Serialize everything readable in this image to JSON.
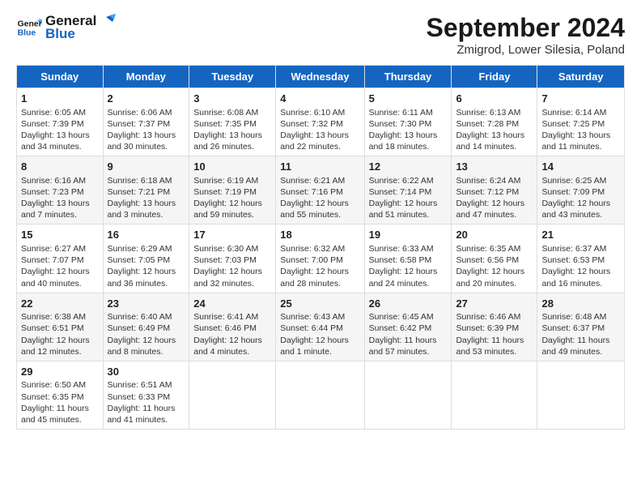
{
  "logo": {
    "line1": "General",
    "line2": "Blue"
  },
  "title": "September 2024",
  "subtitle": "Zmigrod, Lower Silesia, Poland",
  "headers": [
    "Sunday",
    "Monday",
    "Tuesday",
    "Wednesday",
    "Thursday",
    "Friday",
    "Saturday"
  ],
  "weeks": [
    [
      {
        "day": "1",
        "sunrise": "Sunrise: 6:05 AM",
        "sunset": "Sunset: 7:39 PM",
        "daylight": "Daylight: 13 hours and 34 minutes."
      },
      {
        "day": "2",
        "sunrise": "Sunrise: 6:06 AM",
        "sunset": "Sunset: 7:37 PM",
        "daylight": "Daylight: 13 hours and 30 minutes."
      },
      {
        "day": "3",
        "sunrise": "Sunrise: 6:08 AM",
        "sunset": "Sunset: 7:35 PM",
        "daylight": "Daylight: 13 hours and 26 minutes."
      },
      {
        "day": "4",
        "sunrise": "Sunrise: 6:10 AM",
        "sunset": "Sunset: 7:32 PM",
        "daylight": "Daylight: 13 hours and 22 minutes."
      },
      {
        "day": "5",
        "sunrise": "Sunrise: 6:11 AM",
        "sunset": "Sunset: 7:30 PM",
        "daylight": "Daylight: 13 hours and 18 minutes."
      },
      {
        "day": "6",
        "sunrise": "Sunrise: 6:13 AM",
        "sunset": "Sunset: 7:28 PM",
        "daylight": "Daylight: 13 hours and 14 minutes."
      },
      {
        "day": "7",
        "sunrise": "Sunrise: 6:14 AM",
        "sunset": "Sunset: 7:25 PM",
        "daylight": "Daylight: 13 hours and 11 minutes."
      }
    ],
    [
      {
        "day": "8",
        "sunrise": "Sunrise: 6:16 AM",
        "sunset": "Sunset: 7:23 PM",
        "daylight": "Daylight: 13 hours and 7 minutes."
      },
      {
        "day": "9",
        "sunrise": "Sunrise: 6:18 AM",
        "sunset": "Sunset: 7:21 PM",
        "daylight": "Daylight: 13 hours and 3 minutes."
      },
      {
        "day": "10",
        "sunrise": "Sunrise: 6:19 AM",
        "sunset": "Sunset: 7:19 PM",
        "daylight": "Daylight: 12 hours and 59 minutes."
      },
      {
        "day": "11",
        "sunrise": "Sunrise: 6:21 AM",
        "sunset": "Sunset: 7:16 PM",
        "daylight": "Daylight: 12 hours and 55 minutes."
      },
      {
        "day": "12",
        "sunrise": "Sunrise: 6:22 AM",
        "sunset": "Sunset: 7:14 PM",
        "daylight": "Daylight: 12 hours and 51 minutes."
      },
      {
        "day": "13",
        "sunrise": "Sunrise: 6:24 AM",
        "sunset": "Sunset: 7:12 PM",
        "daylight": "Daylight: 12 hours and 47 minutes."
      },
      {
        "day": "14",
        "sunrise": "Sunrise: 6:25 AM",
        "sunset": "Sunset: 7:09 PM",
        "daylight": "Daylight: 12 hours and 43 minutes."
      }
    ],
    [
      {
        "day": "15",
        "sunrise": "Sunrise: 6:27 AM",
        "sunset": "Sunset: 7:07 PM",
        "daylight": "Daylight: 12 hours and 40 minutes."
      },
      {
        "day": "16",
        "sunrise": "Sunrise: 6:29 AM",
        "sunset": "Sunset: 7:05 PM",
        "daylight": "Daylight: 12 hours and 36 minutes."
      },
      {
        "day": "17",
        "sunrise": "Sunrise: 6:30 AM",
        "sunset": "Sunset: 7:03 PM",
        "daylight": "Daylight: 12 hours and 32 minutes."
      },
      {
        "day": "18",
        "sunrise": "Sunrise: 6:32 AM",
        "sunset": "Sunset: 7:00 PM",
        "daylight": "Daylight: 12 hours and 28 minutes."
      },
      {
        "day": "19",
        "sunrise": "Sunrise: 6:33 AM",
        "sunset": "Sunset: 6:58 PM",
        "daylight": "Daylight: 12 hours and 24 minutes."
      },
      {
        "day": "20",
        "sunrise": "Sunrise: 6:35 AM",
        "sunset": "Sunset: 6:56 PM",
        "daylight": "Daylight: 12 hours and 20 minutes."
      },
      {
        "day": "21",
        "sunrise": "Sunrise: 6:37 AM",
        "sunset": "Sunset: 6:53 PM",
        "daylight": "Daylight: 12 hours and 16 minutes."
      }
    ],
    [
      {
        "day": "22",
        "sunrise": "Sunrise: 6:38 AM",
        "sunset": "Sunset: 6:51 PM",
        "daylight": "Daylight: 12 hours and 12 minutes."
      },
      {
        "day": "23",
        "sunrise": "Sunrise: 6:40 AM",
        "sunset": "Sunset: 6:49 PM",
        "daylight": "Daylight: 12 hours and 8 minutes."
      },
      {
        "day": "24",
        "sunrise": "Sunrise: 6:41 AM",
        "sunset": "Sunset: 6:46 PM",
        "daylight": "Daylight: 12 hours and 4 minutes."
      },
      {
        "day": "25",
        "sunrise": "Sunrise: 6:43 AM",
        "sunset": "Sunset: 6:44 PM",
        "daylight": "Daylight: 12 hours and 1 minute."
      },
      {
        "day": "26",
        "sunrise": "Sunrise: 6:45 AM",
        "sunset": "Sunset: 6:42 PM",
        "daylight": "Daylight: 11 hours and 57 minutes."
      },
      {
        "day": "27",
        "sunrise": "Sunrise: 6:46 AM",
        "sunset": "Sunset: 6:39 PM",
        "daylight": "Daylight: 11 hours and 53 minutes."
      },
      {
        "day": "28",
        "sunrise": "Sunrise: 6:48 AM",
        "sunset": "Sunset: 6:37 PM",
        "daylight": "Daylight: 11 hours and 49 minutes."
      }
    ],
    [
      {
        "day": "29",
        "sunrise": "Sunrise: 6:50 AM",
        "sunset": "Sunset: 6:35 PM",
        "daylight": "Daylight: 11 hours and 45 minutes."
      },
      {
        "day": "30",
        "sunrise": "Sunrise: 6:51 AM",
        "sunset": "Sunset: 6:33 PM",
        "daylight": "Daylight: 11 hours and 41 minutes."
      },
      null,
      null,
      null,
      null,
      null
    ]
  ]
}
